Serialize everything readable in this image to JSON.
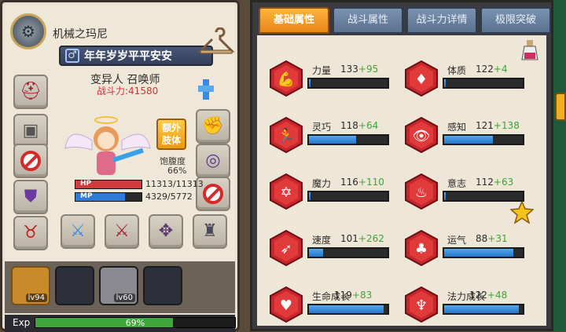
{
  "character": {
    "guild_name": "机械之玛尼",
    "gender_symbol": "♂",
    "player_name": "年年岁岁平平安安",
    "class_line": "变异人 召唤师",
    "power_label": "战斗力:",
    "power_value": "41580",
    "extra_limb_label": "额外\n肢体",
    "satiety_label": "饱腹度",
    "satiety_value": "66%",
    "hp_label": "HP",
    "hp_current": 11313,
    "hp_max": 11313,
    "hp_text": "11313/11313",
    "mp_label": "MP",
    "mp_current": 4329,
    "mp_max": 5772,
    "mp_text": "4329/5772"
  },
  "pets": [
    {
      "level": "lv94",
      "active": true
    },
    {
      "level": "",
      "active": false
    },
    {
      "level": "lv60",
      "active": false
    },
    {
      "level": "",
      "active": false
    }
  ],
  "exp": {
    "label": "Exp",
    "percent": 69,
    "text": "69%"
  },
  "tabs": [
    {
      "label": "基础属性",
      "active": true
    },
    {
      "label": "战斗属性",
      "active": false
    },
    {
      "label": "战斗力详情",
      "active": false
    },
    {
      "label": "极限突破",
      "active": false
    }
  ],
  "stats": [
    {
      "name": "力量",
      "base": "133",
      "bonus": "+95",
      "fill": 0.02,
      "icon": "arm-icon"
    },
    {
      "name": "体质",
      "base": "122",
      "bonus": "+4",
      "fill": 0.02,
      "icon": "torso-icon"
    },
    {
      "name": "灵巧",
      "base": "118",
      "bonus": "+64",
      "fill": 0.6,
      "icon": "runner-icon"
    },
    {
      "name": "感知",
      "base": "121",
      "bonus": "+138",
      "fill": 0.62,
      "icon": "eye-icon"
    },
    {
      "name": "魔力",
      "base": "116",
      "bonus": "+110",
      "fill": 0.02,
      "icon": "hexagram-icon"
    },
    {
      "name": "意志",
      "base": "112",
      "bonus": "+63",
      "fill": 0.02,
      "icon": "flame-head-icon"
    },
    {
      "name": "速度",
      "base": "101",
      "bonus": "+262",
      "fill": 0.18,
      "icon": "wing-icon"
    },
    {
      "name": "运气",
      "base": "88",
      "bonus": "+31",
      "fill": 0.88,
      "icon": "clover-icon"
    },
    {
      "name": "生命成长",
      "base": "119",
      "bonus": "+83",
      "fill": 0.95,
      "icon": "heart-icon"
    },
    {
      "name": "法力成长",
      "base": "122",
      "bonus": "+48",
      "fill": 0.95,
      "icon": "mana-figure-icon"
    }
  ],
  "colors": {
    "accent_orange": "#e8861a",
    "power_red": "#d0323a",
    "bonus_green": "#3aa63a",
    "bar_blue": "#2676c8",
    "hp_red": "#d23b3b",
    "mp_blue": "#2e7ad6"
  },
  "equipment_icons": [
    "helmet-icon",
    "mask-icon",
    "forbidden-icon",
    "cloak-icon",
    "demon-mask-icon",
    "sword-icon",
    "blade-icon",
    "cannon-icon",
    "lantern-icon",
    "gauntlet-icon",
    "collar-icon",
    "forbidden-icon",
    "totem-icon",
    "hanger-icon"
  ]
}
